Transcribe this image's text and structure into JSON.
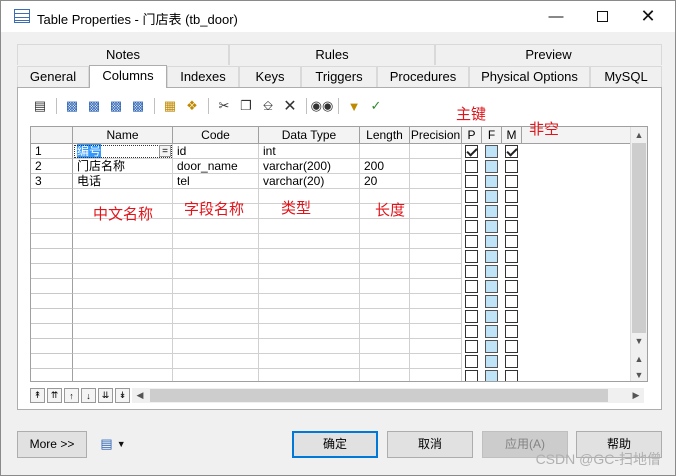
{
  "window": {
    "title": "Table Properties - 门店表 (tb_door)"
  },
  "tabs_top": [
    "Notes",
    "Rules",
    "Preview"
  ],
  "tabs_bottom": [
    "General",
    "Columns",
    "Indexes",
    "Keys",
    "Triggers",
    "Procedures",
    "Physical Options",
    "MySQL"
  ],
  "active_tab": "Columns",
  "grid": {
    "headers": [
      "Name",
      "Code",
      "Data Type",
      "Length",
      "Precision",
      "P",
      "F",
      "M"
    ],
    "rows": [
      {
        "num": "1",
        "name": "编号",
        "code": "id",
        "type": "int",
        "length": "",
        "p": true,
        "m": true
      },
      {
        "num": "2",
        "name": "门店名称",
        "code": "door_name",
        "type": "varchar(200)",
        "length": "200",
        "p": false,
        "m": false
      },
      {
        "num": "3",
        "name": "电话",
        "code": "tel",
        "type": "varchar(20)",
        "length": "20",
        "p": false,
        "m": false
      }
    ],
    "edit_marker": "="
  },
  "annotations": {
    "pk": "主键",
    "notnull": "非空",
    "cn_name": "中文名称",
    "field_name": "字段名称",
    "type": "类型",
    "length": "长度"
  },
  "buttons": {
    "more": "More >>",
    "ok": "确定",
    "cancel": "取消",
    "apply": "应用(A)",
    "help": "帮助"
  },
  "watermark": "CSDN @GC-扫地僧"
}
